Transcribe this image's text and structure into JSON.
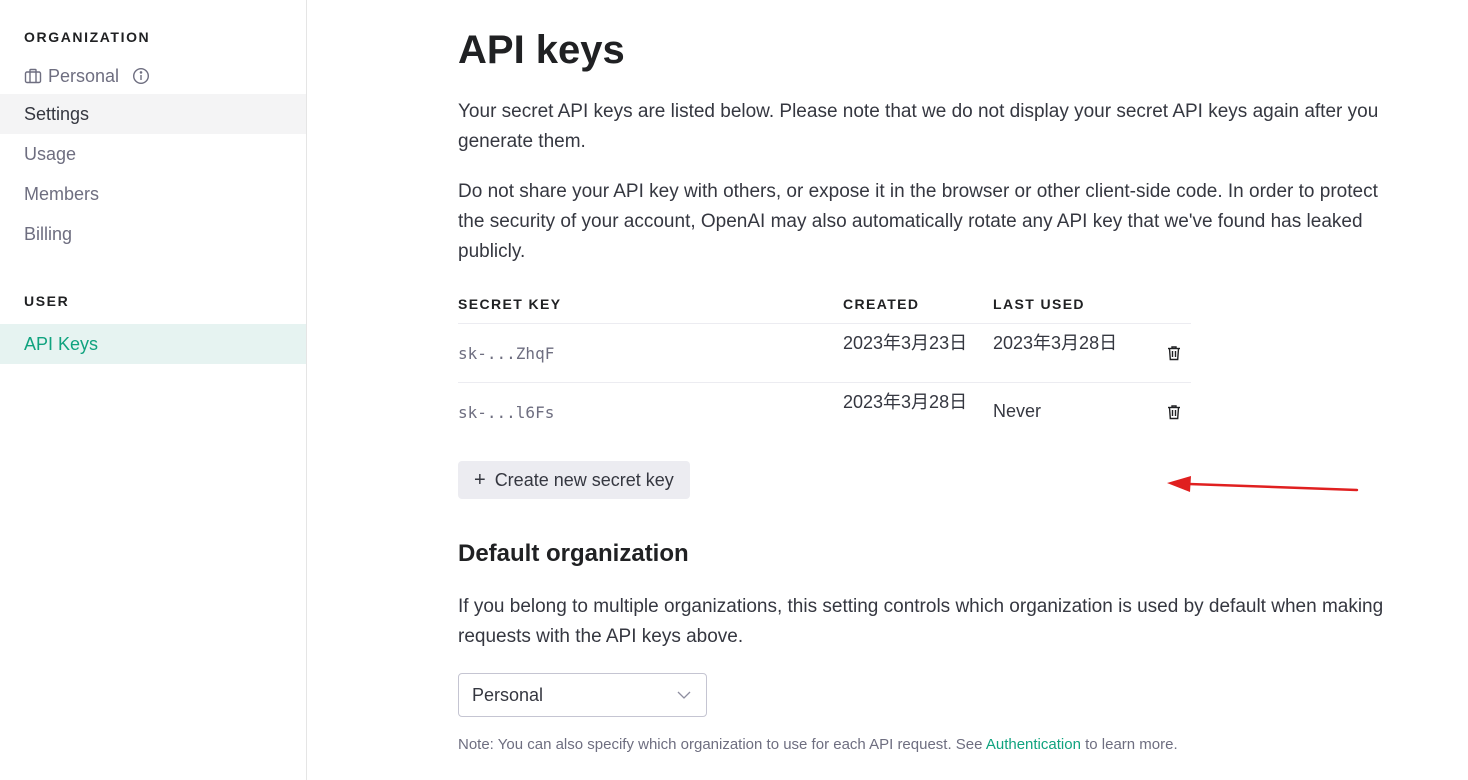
{
  "sidebar": {
    "organization_title": "ORGANIZATION",
    "org_name": "Personal",
    "items": [
      {
        "label": "Settings"
      },
      {
        "label": "Usage"
      },
      {
        "label": "Members"
      },
      {
        "label": "Billing"
      }
    ],
    "user_title": "USER",
    "user_items": [
      {
        "label": "API Keys"
      }
    ]
  },
  "main": {
    "title": "API keys",
    "intro_1": "Your secret API keys are listed below. Please note that we do not display your secret API keys again after you generate them.",
    "intro_2": "Do not share your API key with others, or expose it in the browser or other client-side code. In order to protect the security of your account, OpenAI may also automatically rotate any API key that we've found has leaked publicly.",
    "table": {
      "headers": {
        "secret_key": "SECRET KEY",
        "created": "CREATED",
        "last_used": "LAST USED"
      },
      "rows": [
        {
          "key": "sk-...ZhqF",
          "created": "2023年3月23日",
          "last_used": "2023年3月28日"
        },
        {
          "key": "sk-...l6Fs",
          "created": "2023年3月28日",
          "last_used": "Never"
        }
      ]
    },
    "create_button": {
      "icon": "+",
      "label": "Create new secret key"
    },
    "default_org": {
      "title": "Default organization",
      "description": "If you belong to multiple organizations, this setting controls which organization is used by default when making requests with the API keys above.",
      "selected": "Personal",
      "note_prefix": "Note: You can also specify which organization to use for each API request. See ",
      "note_link": "Authentication",
      "note_suffix": " to learn more."
    }
  },
  "colors": {
    "accent": "#10a37f",
    "annotation_arrow": "#e02020"
  },
  "icons": {
    "org": "briefcase-icon",
    "info": "info-icon",
    "delete": "trash-icon",
    "chevron": "chevron-down-icon",
    "arrow": "red-arrow-annotation"
  }
}
